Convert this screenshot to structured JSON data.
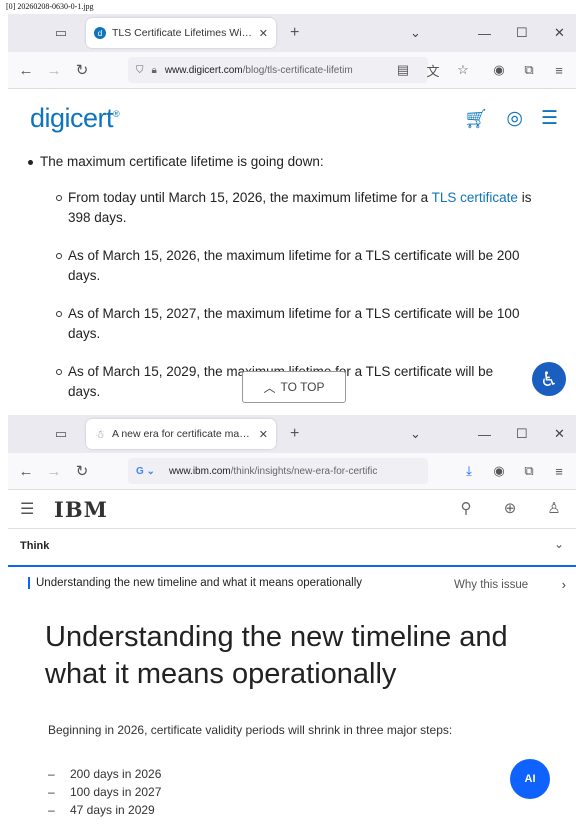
{
  "caption": "[0] 20260208-0630-0-1.jpg",
  "window1": {
    "tab_title": "TLS Certificate Lifetimes Will Ch",
    "url_host": "www.digicert.com",
    "url_path": "/blog/tls-certificate-lifetim",
    "logo": "digicert",
    "intro": "The maximum certificate lifetime is going down:",
    "item1_pre": "From today until March 15, 2026, the maximum lifetime for a ",
    "item1_link": "TLS certificate",
    "item1_post": " is 398 days.",
    "item2": "As of March 15, 2026, the maximum lifetime for a TLS certificate will be 200 days.",
    "item3": "As of March 15, 2027, the maximum lifetime for a TLS certificate will be 100 days.",
    "item4": "As of March 15, 2029, the maximum lifetime for a TLS certificate will be",
    "item4_tail": "days.",
    "to_top": "TO TOP"
  },
  "window2": {
    "tab_title": "A new era for certificate manag",
    "url_host": "www.ibm.com",
    "url_path": "/think/insights/new-era-for-certific",
    "logo": "IBM",
    "think_label": "Think",
    "toc_active": "Understanding the new timeline and what it means operationally",
    "toc_next": "Why this issue",
    "heading": "Understanding the new timeline and what it means operationally",
    "paragraph": "Beginning in 2026, certificate validity periods will shrink in three major steps:",
    "steps": [
      "200 days in 2026",
      "100 days in 2027",
      "47 days in 2029"
    ],
    "ai_label": "AI"
  },
  "colors": {
    "digicert_blue": "#0e75bc",
    "ibm_blue": "#0f62fe",
    "tabbar": "#eceaf1"
  },
  "icons": [
    "tab-manager-icon",
    "close-icon",
    "plus-icon",
    "chevron-down-icon",
    "minimize-icon",
    "maximize-icon",
    "back-arrow-icon",
    "forward-arrow-icon",
    "reload-icon",
    "shield-icon",
    "lock-icon",
    "reader-icon",
    "translate-icon",
    "star-icon",
    "account-icon",
    "extensions-icon",
    "menu-icon",
    "cart-icon",
    "user-icon",
    "hamburger-icon",
    "search-icon",
    "globe-icon",
    "accessibility-icon",
    "download-icon",
    "google-icon"
  ]
}
